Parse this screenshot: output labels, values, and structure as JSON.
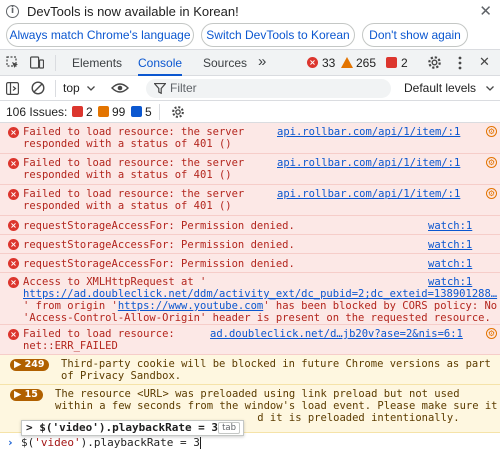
{
  "infobar": {
    "message": "DevTools is now available in Korean!",
    "buttons": [
      "Always match Chrome's language",
      "Switch DevTools to Korean",
      "Don't show again"
    ],
    "close_glyph": "✕"
  },
  "tabs": {
    "items": [
      "Elements",
      "Console",
      "Sources"
    ],
    "active": "Console",
    "more_glyph": "»",
    "counts": {
      "errors": "33",
      "warnings": "265",
      "issues": "2"
    }
  },
  "toolbar": {
    "context": "top",
    "filter_placeholder": "Filter",
    "levels": "Default levels"
  },
  "issues": {
    "label": "106 Issues:",
    "errors": "2",
    "warnings": "99",
    "info": "5"
  },
  "messages": [
    {
      "type": "error",
      "lines": [
        "Failed to load resource: the server",
        "responded with a status of 401 ()"
      ],
      "source": "api.rollbar.com/api/1/item/:1"
    },
    {
      "type": "error",
      "lines": [
        "Failed to load resource: the server",
        "responded with a status of 401 ()"
      ],
      "source": "api.rollbar.com/api/1/item/:1"
    },
    {
      "type": "error",
      "lines": [
        "Failed to load resource: the server",
        "responded with a status of 401 ()"
      ],
      "source": "api.rollbar.com/api/1/item/:1"
    },
    {
      "type": "error",
      "lines": [
        "requestStorageAccessFor: Permission denied."
      ],
      "source": "watch:1"
    },
    {
      "type": "error",
      "lines": [
        "requestStorageAccessFor: Permission denied."
      ],
      "source": "watch:1"
    },
    {
      "type": "error",
      "lines": [
        "requestStorageAccessFor: Permission denied."
      ],
      "source": "watch:1"
    },
    {
      "type": "error",
      "line1": "Access to XMLHttpRequest at '",
      "url1": "https://ad.doubleclick.net/ddm/activity_ext/dc_pubid=2;dc_exteid=138901288…",
      "line3_pre": "' from origin '",
      "url2": "https://www.youtube.com",
      "line3_post": "' has been blocked by CORS policy: No",
      "line4": "'Access-Control-Allow-Origin' header is present on the requested resource.",
      "source": "watch:1"
    },
    {
      "type": "error",
      "lines": [
        "Failed to load resource:",
        "net::ERR_FAILED"
      ],
      "source": "ad.doubleclick.net/d…jb20v?ase=2&nis=6:1"
    },
    {
      "type": "warning",
      "count": "249",
      "lines": [
        "Third-party cookie will be blocked in future Chrome versions as part",
        "of Privacy Sandbox."
      ]
    },
    {
      "type": "warning",
      "count": "15",
      "lines": [
        "The resource <URL> was preloaded using link preload but not used",
        "within a few seconds from the window's load event. Please make sure it",
        "                                d it is preloaded intentionally."
      ]
    }
  ],
  "autocomplete": {
    "suggestion": "> $('video').playbackRate = 3",
    "hint": "tab"
  },
  "prompt": {
    "pre": "$(",
    "string": "'video'",
    "post": ").playbackRate = 3"
  },
  "colors": {
    "accent": "#0b57d0",
    "error": "#dc362e",
    "warning": "#e37400"
  }
}
